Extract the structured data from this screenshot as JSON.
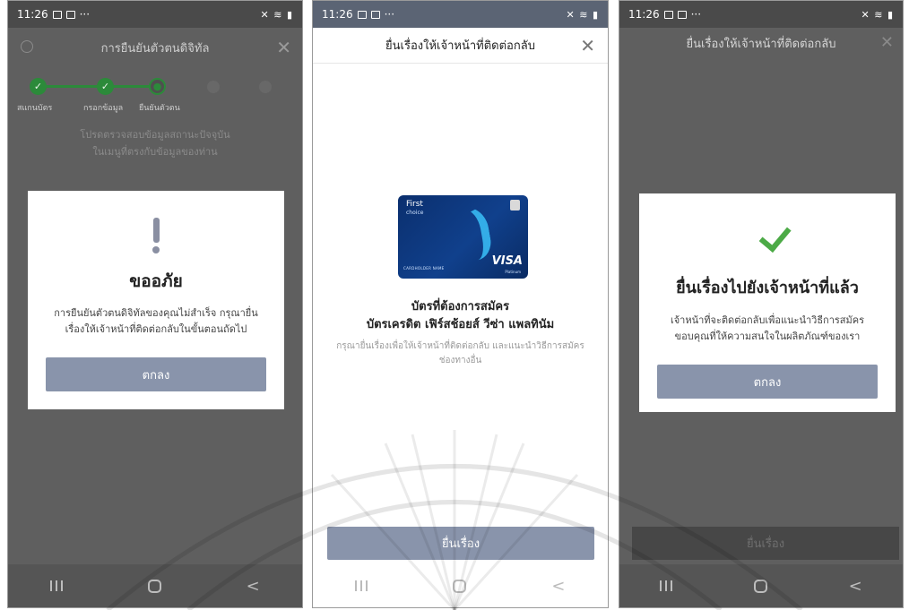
{
  "status": {
    "time": "11:26",
    "dots": "···"
  },
  "panel1": {
    "header_title": "การยืนยันตัวตนดิจิทัล",
    "close_glyph": "✕",
    "steps": [
      {
        "label": "สแกนบัตร",
        "state": "done"
      },
      {
        "label": "กรอกข้อมูล",
        "state": "done"
      },
      {
        "label": "ยืนยันตัวตน",
        "state": "current"
      }
    ],
    "info_line1": "โปรดตรวจสอบข้อมูลสถานะปัจจุบัน",
    "info_line2": "ในเมนูที่ตรงกับข้อมูลของท่าน",
    "dialog": {
      "title": "ขออภัย",
      "message_line1": "การยืนยันตัวตนดิจิทัลของคุณไม่สำเร็จ กรุณายื่น",
      "message_line2": "เรื่องให้เจ้าหน้าที่ติดต่อกลับในขั้นตอนถัดไป",
      "button": "ตกลง"
    }
  },
  "panel2": {
    "header_title": "ยื่นเรื่องให้เจ้าหน้าที่ติดต่อกลับ",
    "close_glyph": "✕",
    "card": {
      "brand": "First",
      "brand_sub": "choice",
      "holder": "CARDHOLDER NAME",
      "network": "VISA",
      "network_sub": "Platinum"
    },
    "title1": "บัตรที่ต้องการสมัคร",
    "title2": "บัตรเครดิต เฟิร์สช้อยส์ วีซ่า แพลทินัม",
    "desc_line1": "กรุณายื่นเรื่องเพื่อให้เจ้าหน้าที่ติดต่อกลับ และแนะนำวิธีการสมัคร",
    "desc_line2": "ช่องทางอื่น",
    "submit_button": "ยื่นเรื่อง"
  },
  "panel3": {
    "header_title": "ยื่นเรื่องให้เจ้าหน้าที่ติดต่อกลับ",
    "close_glyph": "✕",
    "dialog": {
      "title": "ยื่นเรื่องไปยังเจ้าหน้าที่แล้ว",
      "message_line1": "เจ้าหน้าที่จะติดต่อกลับเพื่อแนะนำวิธีการสมัคร",
      "message_line2": "ขอบคุณที่ให้ความสนใจในผลิตภัณฑ์ของเรา",
      "button": "ตกลง"
    },
    "dim_button": "ยื่นเรื่อง"
  },
  "nav": {
    "back_glyph": "<"
  },
  "colors": {
    "success": "#2c8a3a",
    "button": "#8994ab",
    "check": "#4caa46",
    "card": "#10408c"
  }
}
